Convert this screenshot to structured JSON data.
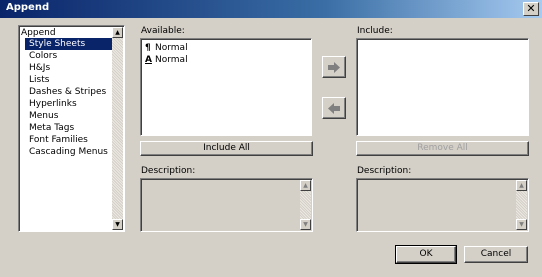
{
  "window": {
    "title": "Append",
    "close_glyph": "✕"
  },
  "tree": {
    "root": "Append",
    "items": [
      {
        "label": "Style Sheets",
        "selected": true
      },
      {
        "label": "Colors"
      },
      {
        "label": "H&Js"
      },
      {
        "label": "Lists"
      },
      {
        "label": "Dashes & Stripes"
      },
      {
        "label": "Hyperlinks"
      },
      {
        "label": "Menus"
      },
      {
        "label": "Meta Tags"
      },
      {
        "label": "Font Families"
      },
      {
        "label": "Cascading Menus"
      }
    ]
  },
  "available": {
    "label": "Available:",
    "items": [
      {
        "icon": "¶",
        "label": "Normal"
      },
      {
        "icon": "A",
        "label": "Normal"
      }
    ],
    "include_all": "Include All",
    "description_label": "Description:"
  },
  "include": {
    "label": "Include:",
    "remove_all": "Remove All",
    "description_label": "Description:"
  },
  "buttons": {
    "ok": "OK",
    "cancel": "Cancel"
  }
}
